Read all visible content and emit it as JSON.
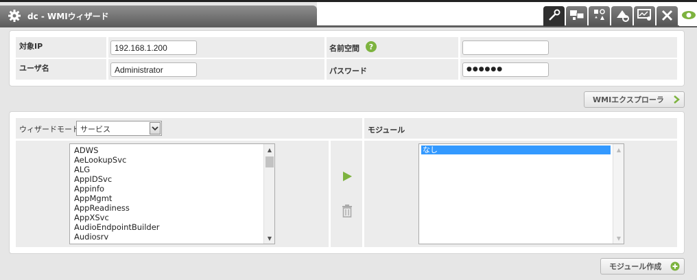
{
  "header": {
    "title": "dc - WMIウィザード",
    "settings_icon": "gear-icon"
  },
  "toolbar": {
    "tools": [
      "wand-icon",
      "network-icon",
      "shapes-icon",
      "alerts-icon",
      "monitor-icon",
      "tools-icon",
      "eye-icon"
    ],
    "active_index": 0,
    "accent": "#7db33f"
  },
  "connection": {
    "target_ip_label": "対象IP",
    "target_ip_value": "192.168.1.200",
    "namespace_label": "名前空間",
    "namespace_value": "",
    "user_label": "ユーザ名",
    "user_value": "Administrator",
    "password_label": "パスワード",
    "password_value": "●●●●●●"
  },
  "wmi_explorer_button": "WMIエクスプローラ",
  "wizard": {
    "mode_label": "ウィザードモード :",
    "mode_value": "サービス",
    "modules_header": "モジュール",
    "services": [
      "ADWS",
      "AeLookupSvc",
      "ALG",
      "AppIDSvc",
      "Appinfo",
      "AppMgmt",
      "AppReadiness",
      "AppXSvc",
      "AudioEndpointBuilder",
      "Audiosrv"
    ],
    "modules": [
      "なし"
    ]
  },
  "create_module_button": "モジュール作成"
}
